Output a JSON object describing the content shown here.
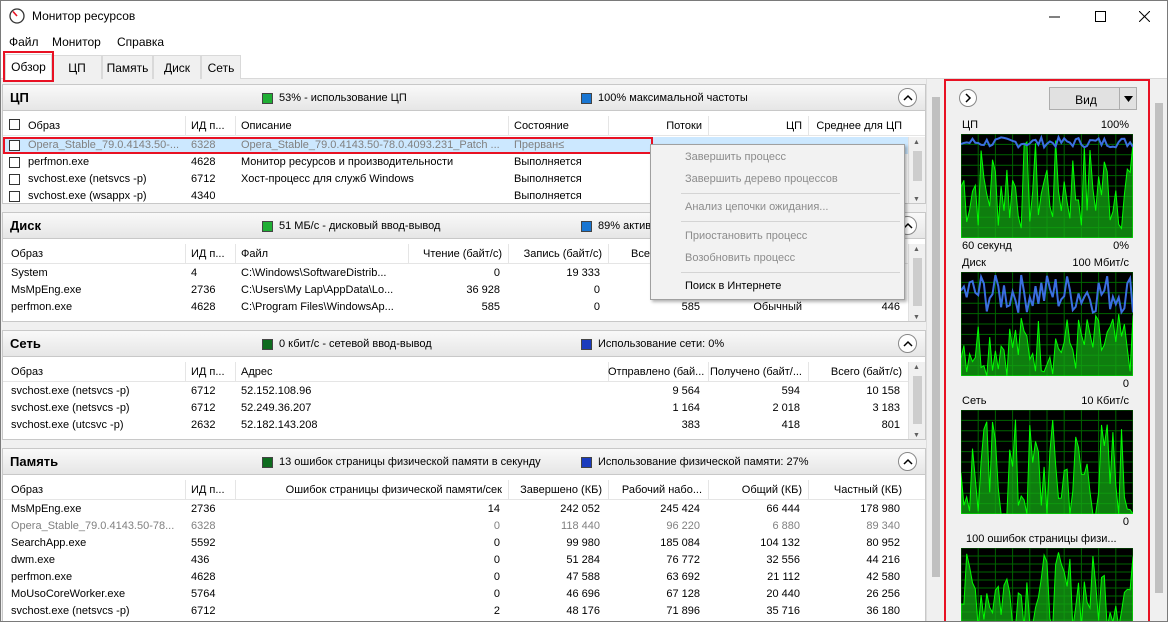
{
  "window": {
    "title": "Монитор ресурсов"
  },
  "menu": [
    "Файл",
    "Монитор",
    "Справка"
  ],
  "tabs": [
    "Обзор",
    "ЦП",
    "Память",
    "Диск",
    "Сеть"
  ],
  "cpu": {
    "title": "ЦП",
    "ind1": "53% - использование ЦП",
    "ind2": "100% максимальной частоты",
    "headers": [
      "Образ",
      "ИД п...",
      "Описание",
      "Состояние",
      "Потоки",
      "ЦП",
      "Среднее для ЦП"
    ],
    "rows": [
      {
        "image": "Opera_Stable_79.0.4143.50-...",
        "pid": "6328",
        "desc": "Opera_Stable_79.0.4143.50-78.0.4093.231_Patch ...",
        "state": "Прерван≤"
      },
      {
        "image": "perfmon.exe",
        "pid": "4628",
        "desc": "Монитор ресурсов и производительности",
        "state": "Выполняется"
      },
      {
        "image": "svchost.exe (netsvcs -p)",
        "pid": "6712",
        "desc": "Хост-процесс для служб Windows",
        "state": "Выполняется"
      },
      {
        "image": "svchost.exe (wsappx -p)",
        "pid": "4340",
        "desc": "",
        "state": "Выполняется"
      }
    ]
  },
  "disk": {
    "title": "Диск",
    "ind1": "51 МБ/с - дисковый ввод-вывод",
    "ind2": "89% активн",
    "headers": [
      "Образ",
      "ИД п...",
      "Файл",
      "Чтение (байт/с)",
      "Запись (байт/с)",
      "Всего"
    ],
    "rows": [
      {
        "image": "System",
        "pid": "4",
        "file": "C:\\Windows\\SoftwareDistrib...",
        "read": "0",
        "write": "19 333",
        "prio": "",
        "resp": ""
      },
      {
        "image": "MsMpEng.exe",
        "pid": "2736",
        "file": "C:\\Users\\My Lap\\AppData\\Lo...",
        "read": "36 928",
        "write": "0",
        "prio": "",
        "resp": ""
      },
      {
        "image": "perfmon.exe",
        "pid": "4628",
        "file": "C:\\Program Files\\WindowsAp...",
        "read": "585",
        "write": "0",
        "total": "585",
        "prio": "Обычный",
        "resp": "446"
      }
    ]
  },
  "net": {
    "title": "Сеть",
    "ind1": "0 кбит/с - сетевой ввод-вывод",
    "ind2": "Использование сети: 0%",
    "headers": [
      "Образ",
      "ИД п...",
      "Адрес",
      "Отправлено (бай...",
      "Получено (байт/...",
      "Всего (байт/с)"
    ],
    "rows": [
      {
        "image": "svchost.exe (netsvcs -p)",
        "pid": "6712",
        "addr": "52.152.108.96",
        "sent": "9 564",
        "recv": "594",
        "total": "10 158"
      },
      {
        "image": "svchost.exe (netsvcs -p)",
        "pid": "6712",
        "addr": "52.249.36.207",
        "sent": "1 164",
        "recv": "2 018",
        "total": "3 183"
      },
      {
        "image": "svchost.exe (utcsvc -p)",
        "pid": "2632",
        "addr": "52.182.143.208",
        "sent": "383",
        "recv": "418",
        "total": "801"
      }
    ]
  },
  "mem": {
    "title": "Память",
    "ind1": "13 ошибок страницы физической памяти в секунду",
    "ind2": "Использование физической памяти: 27%",
    "headers": [
      "Образ",
      "ИД п...",
      "Ошибок страницы физической памяти/сек",
      "Завершено (КБ)",
      "Рабочий набо...",
      "Общий (КБ)",
      "Частный (КБ)"
    ],
    "rows": [
      {
        "image": "MsMpEng.exe",
        "pid": "2736",
        "faults": "14",
        "commit": "242 052",
        "ws": "245 424",
        "shared": "66 444",
        "private": "178 980"
      },
      {
        "image": "Opera_Stable_79.0.4143.50-78...",
        "pid": "6328",
        "faults": "0",
        "commit": "118 440",
        "ws": "96 220",
        "shared": "6 880",
        "private": "89 340"
      },
      {
        "image": "SearchApp.exe",
        "pid": "5592",
        "faults": "0",
        "commit": "99 980",
        "ws": "185 084",
        "shared": "104 132",
        "private": "80 952"
      },
      {
        "image": "dwm.exe",
        "pid": "436",
        "faults": "0",
        "commit": "51 284",
        "ws": "76 772",
        "shared": "32 556",
        "private": "44 216"
      },
      {
        "image": "perfmon.exe",
        "pid": "4628",
        "faults": "0",
        "commit": "47 588",
        "ws": "63 692",
        "shared": "21 112",
        "private": "42 580"
      },
      {
        "image": "MoUsoCoreWorker.exe",
        "pid": "5764",
        "faults": "0",
        "commit": "46 696",
        "ws": "67 128",
        "shared": "20 440",
        "private": "26 256"
      },
      {
        "image": "svchost.exe (netsvcs -p)",
        "pid": "6712",
        "faults": "2",
        "commit": "48 176",
        "ws": "71 896",
        "shared": "35 716",
        "private": "36 180"
      }
    ]
  },
  "context_menu": [
    {
      "label": "Завершить процесс",
      "enabled": false
    },
    {
      "label": "Завершить дерево процессов",
      "enabled": false
    },
    {
      "label": "Анализ цепочки ожидания...",
      "enabled": false
    },
    {
      "label": "Приостановить процесс",
      "enabled": false
    },
    {
      "label": "Возобновить процесс",
      "enabled": false
    },
    {
      "label": "Поиск в Интернете",
      "enabled": true
    }
  ],
  "right_panel": {
    "view_button": "Вид",
    "cpu_label": "ЦП",
    "cpu_max": "100%",
    "cpu_time": "60 секунд",
    "cpu_min": "0%",
    "disk_label": "Диск",
    "disk_max": "100 Мбит/с",
    "disk_min": "0",
    "net_label": "Сеть",
    "net_max": "10 Кбит/с",
    "net_min": "0",
    "mem_label": "100 ошибок страницы физи..."
  },
  "colors": {
    "highlight": "#e81123",
    "graph_green": "#00ff00",
    "graph_blue": "#3a6fe0",
    "selected_row": "#cce8ff"
  }
}
